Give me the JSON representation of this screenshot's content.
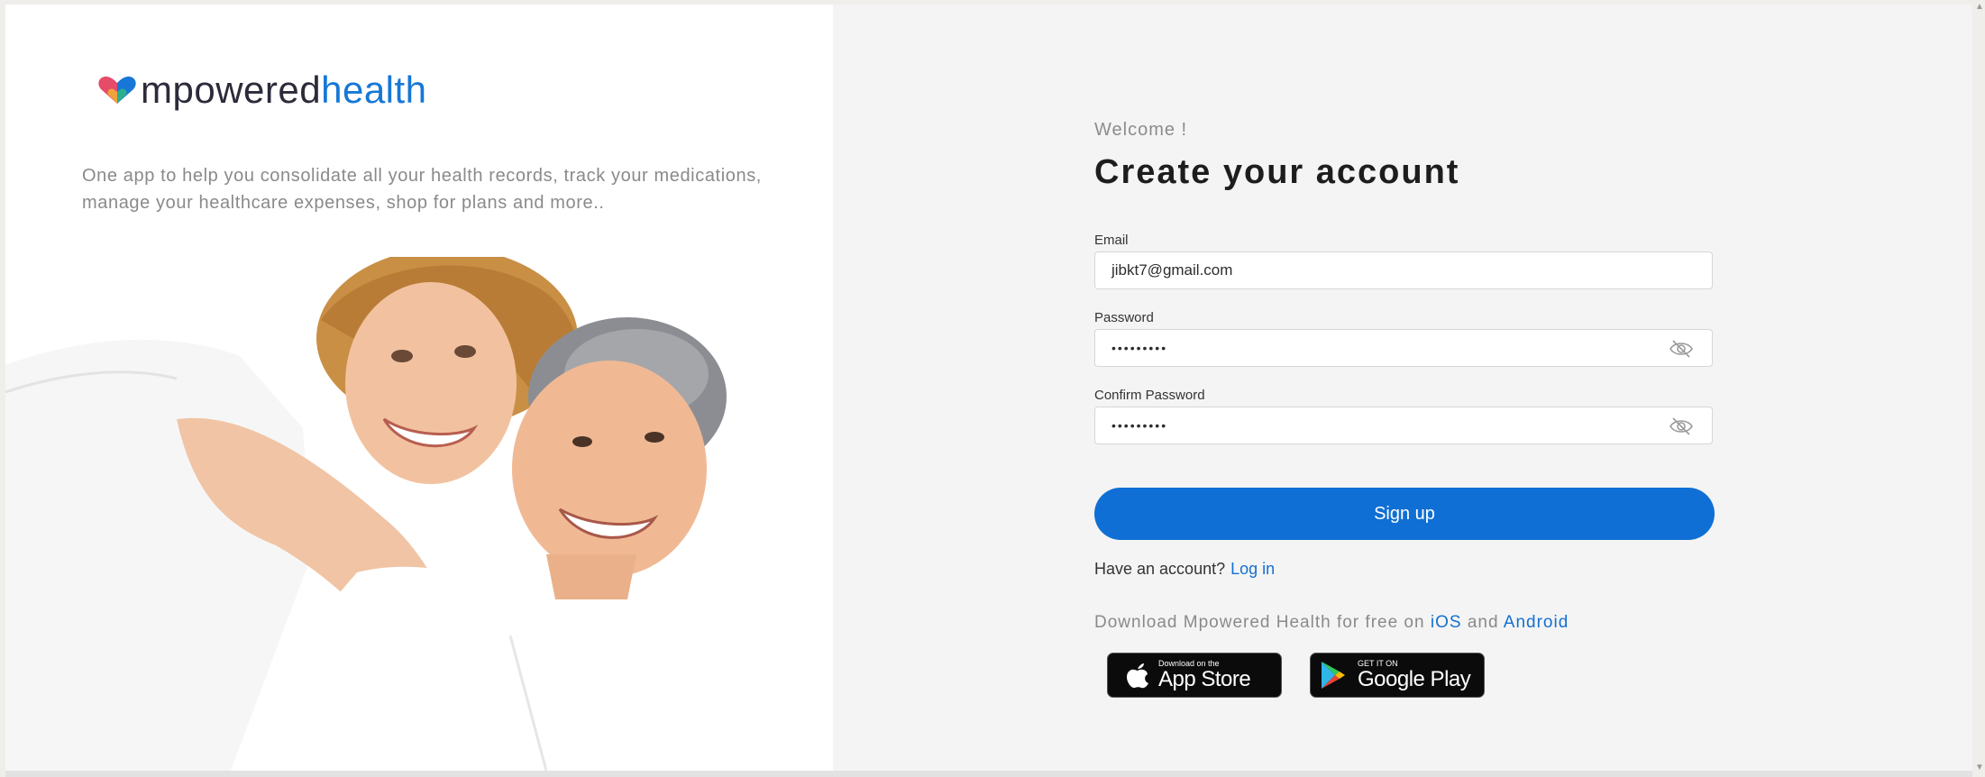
{
  "brand": {
    "logo_part1": "mpowered",
    "logo_part2": "health",
    "tagline": "One app to help you consolidate all your health records, track your medications, manage your healthcare expenses, shop for plans and more..",
    "accent_color": "#1677d6",
    "primary_button_color": "#0f6fd4"
  },
  "form": {
    "welcome": "Welcome !",
    "title": "Create your account",
    "email_label": "Email",
    "email_value": "jibkt7@gmail.com",
    "password_label": "Password",
    "password_value": "•••••••••",
    "confirm_label": "Confirm Password",
    "confirm_value": "•••••••••",
    "signup_label": "Sign up",
    "have_account": "Have an account?",
    "login_link": "Log in",
    "download_prefix": "Download Mpowered Health for free on",
    "ios_link": "iOS",
    "and_text": "and",
    "android_link": "Android"
  },
  "badges": {
    "apple_small": "Download on the",
    "apple_big": "App Store",
    "google_small": "GET IT ON",
    "google_big": "Google Play"
  },
  "icons": {
    "logo": "heart-logo-icon",
    "password_toggle": "eye-slash-icon",
    "apple": "apple-icon",
    "google_play": "google-play-icon"
  }
}
